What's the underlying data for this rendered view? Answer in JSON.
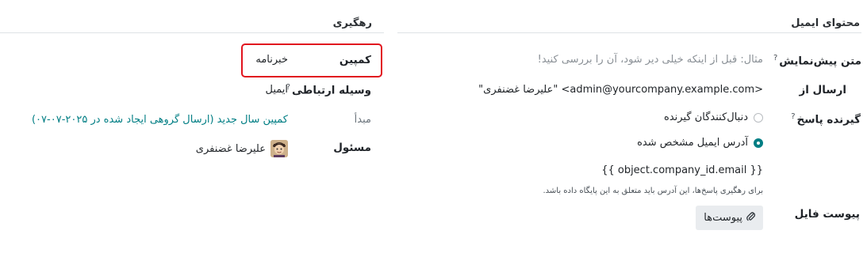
{
  "tracking": {
    "title": "رهگیری",
    "campaign_label": "کمپین",
    "campaign_value": "خبرنامه",
    "medium_label": "وسیله ارتباطی",
    "medium_value": "ایمیل",
    "source_label": "مبدأ",
    "source_value": "کمپین سال جدید (ارسال گروهی ایجاد شده در ۲۰۲۵-۰۷-۰۷)",
    "responsible_label": "مسئول",
    "responsible_value": "علیرضا غضنفری"
  },
  "email_content": {
    "title": "محتوای ایمیل",
    "preview_label": "متن پیش‌نمایش",
    "preview_placeholder": "مثال: قبل از اینکه خیلی دیر شود، آن را بررسی کنید!",
    "from_label": "ارسال از",
    "from_value": "\"علیرضا غضنفری\" <admin@yourcompany.example.com>",
    "reply_to_label": "گیرنده پاسخ",
    "reply_options": [
      {
        "label": "دنبال‌کنندگان گیرنده",
        "selected": false
      },
      {
        "label": "آدرس ایمیل مشخص شده",
        "selected": true
      }
    ],
    "reply_to_value": "{{ object.company_id.email }}",
    "reply_to_help": "برای رهگیری پاسخ‌ها، این آدرس باید متعلق به این پایگاه داده باشد.",
    "attachment_label": "پیوست فایل",
    "attachments_button": "پیوست‌ها"
  },
  "help_marker": "?",
  "icons": {
    "help": "help-icon",
    "paperclip": "paperclip-icon",
    "avatar": "user-avatar"
  },
  "colors": {
    "accent": "#017e84",
    "highlight": "#e1141e"
  }
}
